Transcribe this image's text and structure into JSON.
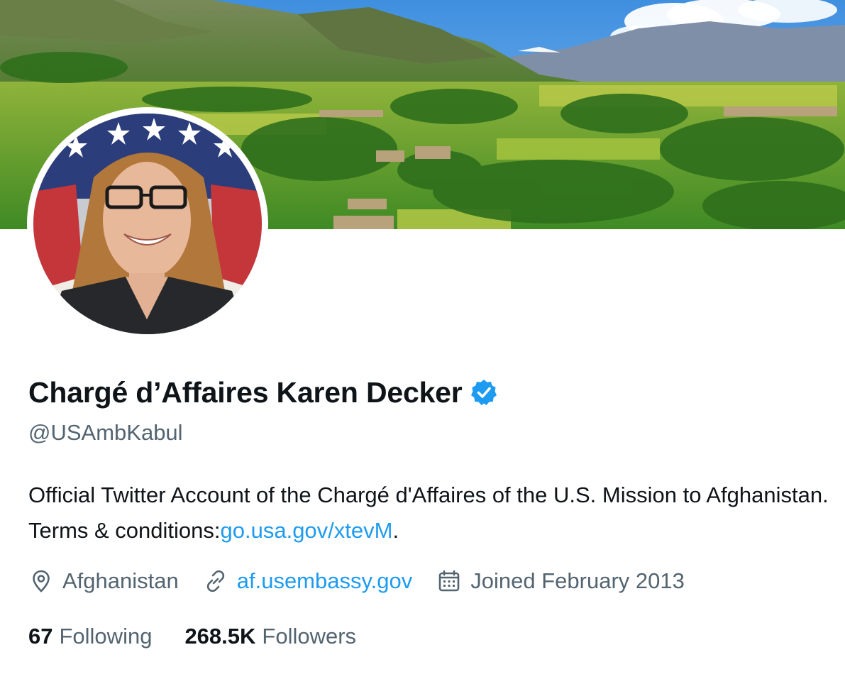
{
  "profile": {
    "display_name": "Chargé d’Affaires Karen Decker",
    "handle": "@USAmbKabul",
    "verified": true,
    "bio_text": "Official Twitter Account of the Chargé d'Affaires of the U.S. Mission to Afghanistan. Terms & conditions:",
    "bio_link": "go.usa.gov/xtevM",
    "bio_suffix": "."
  },
  "meta": {
    "location": "Afghanistan",
    "location_icon": "location-pin-icon",
    "website": "af.usembassy.gov",
    "website_icon": "link-icon",
    "joined": "Joined February 2013",
    "joined_icon": "calendar-icon"
  },
  "stats": {
    "following_count": "67",
    "following_label": "Following",
    "followers_count": "268.5K",
    "followers_label": "Followers"
  },
  "colors": {
    "accent": "#1d9bf0",
    "text_primary": "#0f1419",
    "text_secondary": "#536471",
    "verified_badge": "#1d9bf0"
  },
  "images": {
    "banner": "afghan-valley-landscape-banner",
    "avatar": "portrait-with-us-flag-avatar"
  }
}
